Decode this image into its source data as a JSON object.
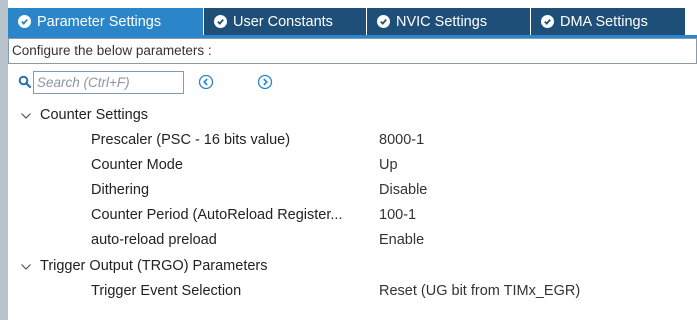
{
  "tabs": [
    {
      "label": "Parameter Settings",
      "active": true
    },
    {
      "label": "User Constants",
      "active": false
    },
    {
      "label": "NVIC Settings",
      "active": false
    },
    {
      "label": "DMA Settings",
      "active": false
    }
  ],
  "info_bar": {
    "text": "Configure the below parameters :"
  },
  "search": {
    "placeholder": "Search (Ctrl+F)",
    "value": ""
  },
  "groups": [
    {
      "label": "Counter Settings",
      "expanded": true,
      "params": [
        {
          "name": "Prescaler (PSC - 16 bits value)",
          "value": "8000-1"
        },
        {
          "name": "Counter Mode",
          "value": "Up"
        },
        {
          "name": "Dithering",
          "value": "Disable"
        },
        {
          "name": "Counter Period (AutoReload Register...",
          "value": "100-1"
        },
        {
          "name": "auto-reload preload",
          "value": "Enable"
        }
      ]
    },
    {
      "label": "Trigger Output (TRGO) Parameters",
      "expanded": true,
      "params": [
        {
          "name": "Trigger Event Selection",
          "value": "Reset (UG bit from TIMx_EGR)"
        }
      ]
    }
  ],
  "colors": {
    "tab_active": "#2a86c8",
    "tab_inactive": "#1e4f79",
    "accent": "#2a86c8"
  }
}
